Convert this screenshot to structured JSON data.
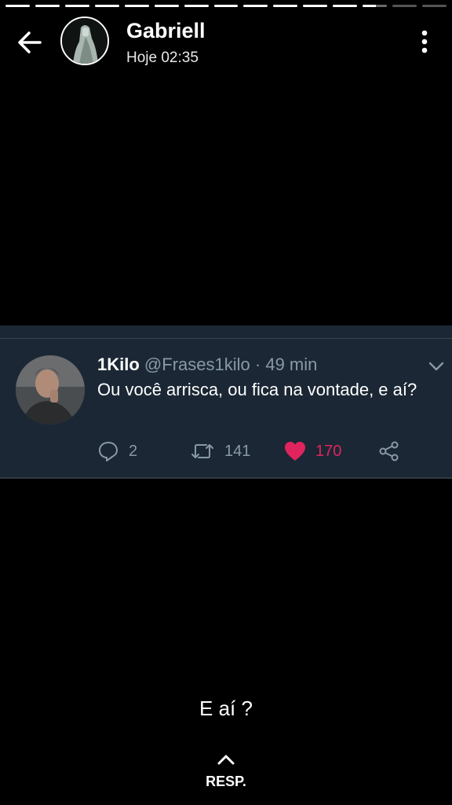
{
  "story": {
    "segments_total": 15,
    "segments_completed": 12,
    "current_segment_progress": 0.55
  },
  "header": {
    "back_icon": "arrow-left-icon",
    "user_name": "Gabriell",
    "timestamp": "Hoje 02:35",
    "more_icon": "more-vertical-icon"
  },
  "tweet": {
    "display_name": "1Kilo",
    "handle": "@Frases1kilo",
    "separator": "·",
    "time_ago": "49 min",
    "text": "Ou você arrisca, ou fica na vontade, e aí?",
    "actions": {
      "replies": "2",
      "retweets": "141",
      "likes": "170"
    },
    "like_color": "#e0245e",
    "background_color": "#1b2734"
  },
  "caption": "E aí ?",
  "reply": {
    "label": "RESP.",
    "icon": "chevron-up-icon"
  }
}
